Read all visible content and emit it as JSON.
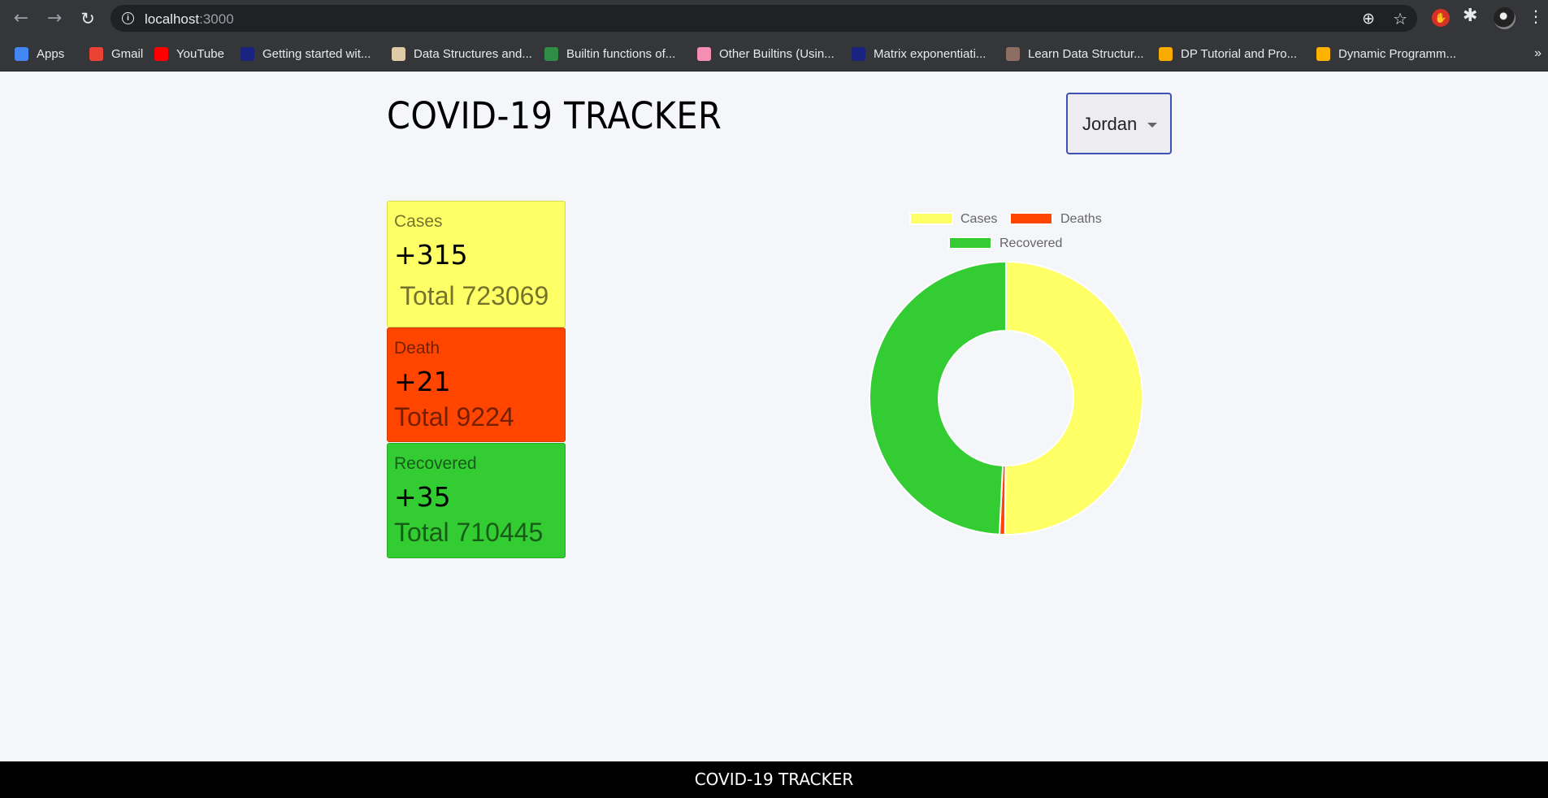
{
  "browser": {
    "url_host": "localhost",
    "url_port": ":3000",
    "bookmarks": [
      {
        "label": "Apps",
        "icon": "apps-grid-icon",
        "color": "#4285f4"
      },
      {
        "label": "Gmail",
        "icon": "gmail-icon",
        "color": "#ea4335"
      },
      {
        "label": "YouTube",
        "icon": "youtube-icon",
        "color": "#ff0000"
      },
      {
        "label": "Getting started wit...",
        "icon": "site-icon",
        "color": "#1a237e"
      },
      {
        "label": "Data Structures and...",
        "icon": "site-icon",
        "color": "#e0c9a6"
      },
      {
        "label": "Builtin functions of...",
        "icon": "geeksforgeeks-icon",
        "color": "#2f8d46"
      },
      {
        "label": "Other Builtins (Usin...",
        "icon": "site-icon",
        "color": "#f48fb1"
      },
      {
        "label": "Matrix exponentiati...",
        "icon": "site-icon",
        "color": "#1a237e"
      },
      {
        "label": "Learn Data Structur...",
        "icon": "codechef-icon",
        "color": "#8d6e63"
      },
      {
        "label": "DP Tutorial and Pro...",
        "icon": "chart-bars-icon",
        "color": "#f9ab00"
      },
      {
        "label": "Dynamic Programm...",
        "icon": "site-icon",
        "color": "#ffb300"
      }
    ],
    "more_label": "»"
  },
  "page": {
    "title": "COVID-19 TRACKER",
    "country": "Jordan",
    "footer": "COVID-19 TRACKER"
  },
  "cards": {
    "cases": {
      "label": "Cases",
      "delta": "+315",
      "total": "Total 723069"
    },
    "deaths": {
      "label": "Death",
      "delta": "+21",
      "total": "Total 9224"
    },
    "recovered": {
      "label": "Recovered",
      "delta": "+35",
      "total": "Total 710445"
    }
  },
  "chart_data": {
    "type": "pie",
    "subtype": "doughnut",
    "categories": [
      "Cases",
      "Deaths",
      "Recovered"
    ],
    "values": [
      723069,
      9224,
      710445
    ],
    "colors": [
      "#ffff66",
      "#ff4500",
      "#33cc33"
    ],
    "legend": "top"
  }
}
